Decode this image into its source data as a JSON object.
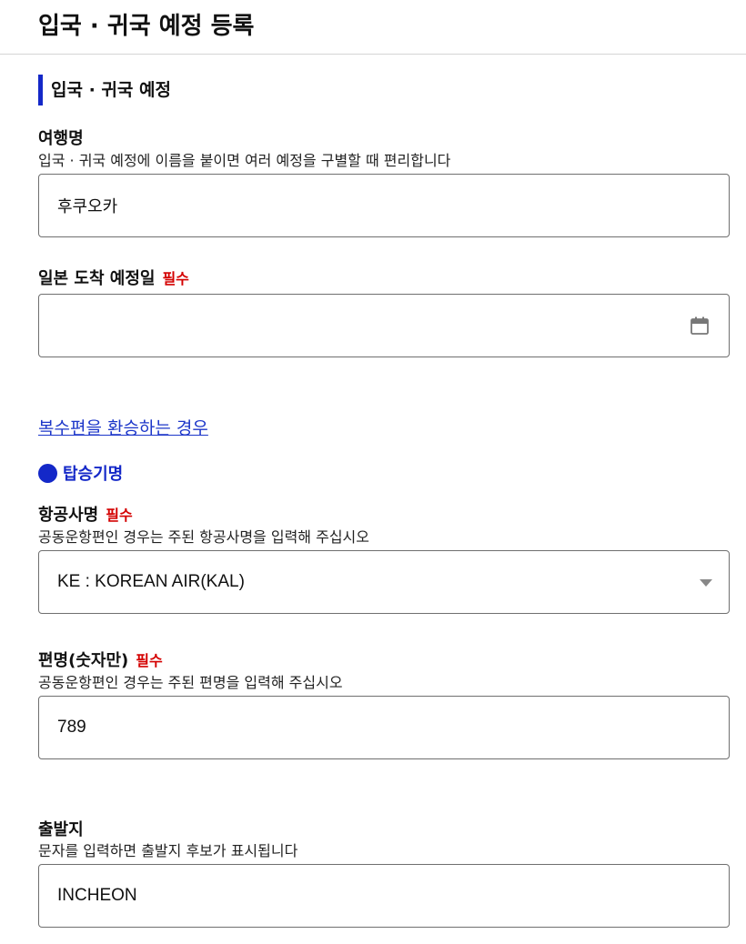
{
  "page": {
    "title": "입국 · 귀국 예정 등록"
  },
  "section": {
    "title": "입국 · 귀국 예정"
  },
  "trip_name": {
    "label": "여행명",
    "hint": "입국 · 귀국 예정에 이름을 붙이면 여러 예정을 구별할 때 편리합니다",
    "value": "후쿠오카"
  },
  "arrival_date": {
    "label": "일본 도착 예정일",
    "required": "필수",
    "value": "",
    "icon": "calendar-icon"
  },
  "multi_flight_link": "복수편을 환승하는 경우",
  "flight_section": {
    "title": "탑승기명"
  },
  "airline": {
    "label": "항공사명",
    "required": "필수",
    "hint": "공동운항편인 경우는 주된 항공사명을 입력해 주십시오",
    "selected": "KE : KOREAN AIR(KAL)",
    "icon": "caret-down-icon"
  },
  "flight_number": {
    "label": "편명(숫자만)",
    "required": "필수",
    "hint": "공동운항편인 경우는 주된 편명을 입력해 주십시오",
    "value": "789"
  },
  "departure": {
    "label": "출발지",
    "hint": "문자를 입력하면 출발지 후보가 표시됩니다",
    "value": "INCHEON"
  },
  "colors": {
    "accent": "#1428c8",
    "required": "#d40000",
    "link": "#1c36c9",
    "border": "#6f6f6f"
  }
}
